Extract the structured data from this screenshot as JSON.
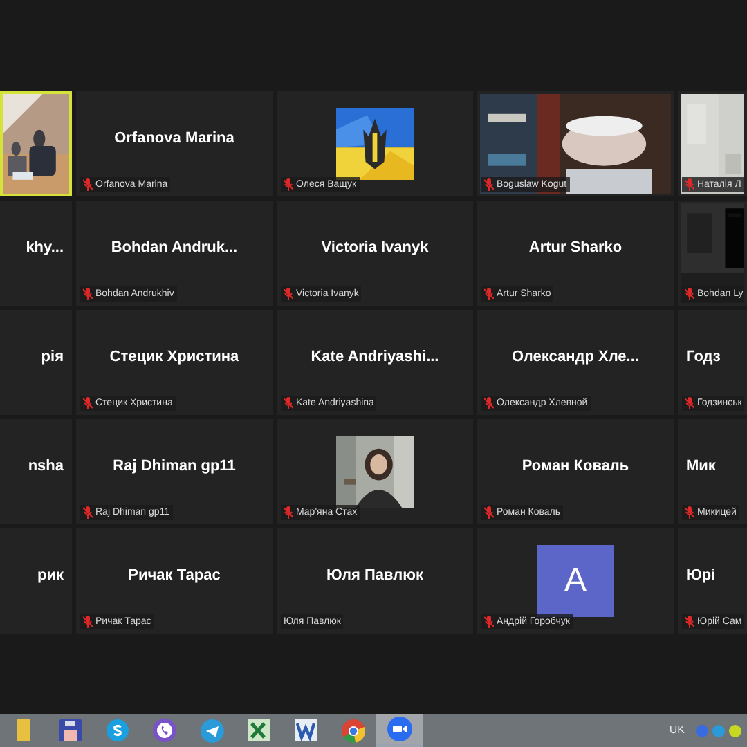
{
  "gallery": {
    "rows": [
      [
        {
          "kind": "video",
          "speaking": true
        },
        {
          "kind": "name",
          "name": "Orfanova Marina",
          "label": "Orfanova Marina",
          "muted": true,
          "speaking": false
        },
        {
          "label": "Олеся Ващук",
          "muted": true,
          "speaking": false
        },
        {
          "kind": "video",
          "label": "Boguslaw Kogut",
          "muted": true,
          "speaking": false
        },
        {
          "kind": "video",
          "label": "Наталія Л",
          "muted": true,
          "speaking": false
        }
      ],
      [
        {
          "kind": "name",
          "name": "khy...",
          "speaking": false
        },
        {
          "kind": "name",
          "name": "Bohdan  Andruk...",
          "label": "Bohdan Andrukhiv",
          "muted": true,
          "speaking": false
        },
        {
          "kind": "name",
          "name": "Victoria Ivanyk",
          "label": "Victoria Ivanyk",
          "muted": true,
          "speaking": false
        },
        {
          "kind": "name",
          "name": "Artur Sharko",
          "label": "Artur Sharko",
          "muted": true,
          "speaking": false
        },
        {
          "kind": "video",
          "label": "Bohdan Ly",
          "muted": true,
          "speaking": false
        }
      ],
      [
        {
          "kind": "name",
          "name": "рія",
          "speaking": false
        },
        {
          "kind": "name",
          "name": "Стецик Христина",
          "label": "Стецик Христина",
          "muted": true,
          "speaking": false
        },
        {
          "kind": "name",
          "name": "Kate  Andriyashi...",
          "label": "Kate Andriyashina",
          "muted": true,
          "speaking": false
        },
        {
          "kind": "name",
          "name": "Олександр  Хле...",
          "label": "Олександр Хлевной",
          "muted": true,
          "speaking": false
        },
        {
          "kind": "name",
          "name": "Годз",
          "label": "Годзинськ",
          "muted": true,
          "speaking": false
        }
      ],
      [
        {
          "kind": "name",
          "name": "nsha",
          "speaking": false
        },
        {
          "kind": "name",
          "name": "Raj Dhiman gp11",
          "label": "Raj Dhiman gp11",
          "muted": true,
          "speaking": false
        },
        {
          "label": "Мар'яна Стах",
          "muted": true,
          "speaking": false
        },
        {
          "kind": "name",
          "name": "Роман Коваль",
          "label": "Роман Коваль",
          "muted": true,
          "speaking": false
        },
        {
          "kind": "name",
          "name": "Мик",
          "label": "Микицей",
          "muted": true,
          "speaking": false
        }
      ],
      [
        {
          "kind": "name",
          "name": "рик",
          "speaking": false
        },
        {
          "kind": "name",
          "name": "Ричак Тарас",
          "label": "Ричак Тарас",
          "muted": true,
          "speaking": false
        },
        {
          "kind": "name",
          "name": "Юля Павлюк",
          "label": "Юля Павлюк",
          "muted": false,
          "speaking": false
        },
        {
          "kind": "avatar",
          "initial": "A",
          "label": "Андрій Горобчук",
          "muted": true,
          "speaking": false
        },
        {
          "kind": "name",
          "name": "Юрі",
          "label": "Юрій Сам",
          "muted": true,
          "speaking": false
        }
      ]
    ]
  },
  "taskbar": {
    "apps": [
      {
        "kind": "folder",
        "selected": false
      },
      {
        "kind": "disk",
        "selected": false
      },
      {
        "kind": "skype",
        "selected": false
      },
      {
        "kind": "viber",
        "selected": false
      },
      {
        "kind": "telegram",
        "selected": false
      },
      {
        "kind": "excel",
        "selected": false
      },
      {
        "kind": "word",
        "selected": false
      },
      {
        "kind": "chrome",
        "selected": false
      },
      {
        "kind": "zoom",
        "selected": true
      }
    ],
    "language": "UK"
  }
}
